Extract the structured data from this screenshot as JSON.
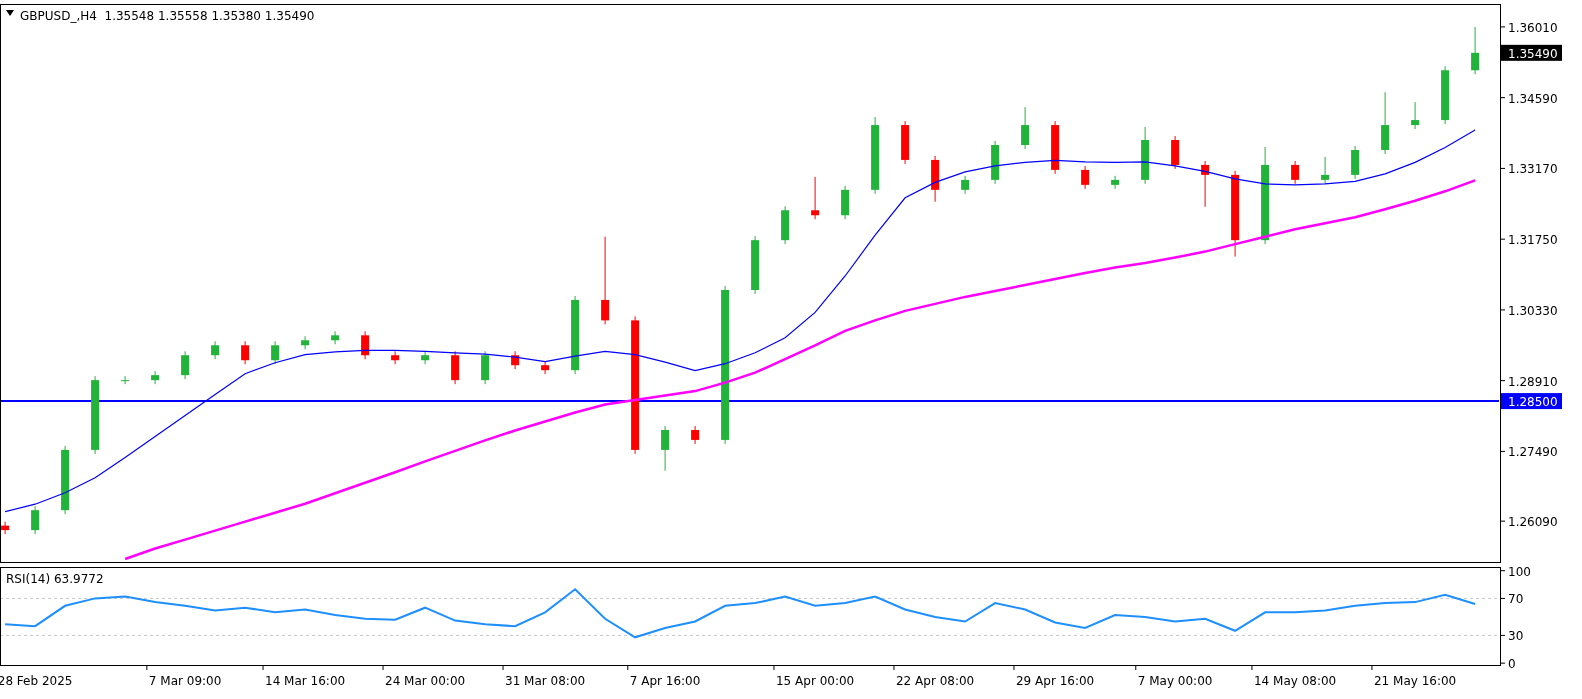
{
  "price_chart": {
    "header": "GBPUSD_,H4  1.35548 1.35558 1.35380 1.35490",
    "current_price": "1.35490",
    "chart_data": {
      "type": "candlestick",
      "categories": [
        null,
        null,
        null,
        null,
        null,
        null,
        null,
        null,
        null,
        null,
        null,
        null,
        null,
        null,
        null,
        null,
        null,
        null,
        null,
        null,
        null,
        null,
        null,
        null,
        null,
        null,
        null,
        null,
        null,
        null,
        null,
        null,
        null,
        null,
        null,
        null,
        null,
        null,
        null,
        null,
        null,
        null,
        null,
        null,
        null,
        null,
        null,
        null,
        null,
        null
      ],
      "ohlc": [
        [
          1.26,
          1.2608,
          1.2583,
          1.2591
        ],
        [
          1.2591,
          1.2639,
          1.2583,
          1.2631
        ],
        [
          1.2631,
          1.276,
          1.2623,
          1.2752
        ],
        [
          1.2752,
          1.29,
          1.2744,
          1.2892
        ],
        [
          1.2892,
          1.29,
          1.2884,
          1.2892
        ],
        [
          1.2892,
          1.291,
          1.2884,
          1.2902
        ],
        [
          1.2902,
          1.295,
          1.2894,
          1.2942
        ],
        [
          1.2942,
          1.297,
          1.2934,
          1.2962
        ],
        [
          1.2962,
          1.297,
          1.2924,
          1.2932
        ],
        [
          1.2932,
          1.297,
          1.2924,
          1.2962
        ],
        [
          1.2962,
          1.298,
          1.2954,
          1.2972
        ],
        [
          1.2972,
          1.299,
          1.2964,
          1.2982
        ],
        [
          1.2982,
          1.299,
          1.2934,
          1.2942
        ],
        [
          1.2942,
          1.295,
          1.2924,
          1.2932
        ],
        [
          1.2932,
          1.295,
          1.2924,
          1.2942
        ],
        [
          1.2942,
          1.295,
          1.2884,
          1.2892
        ],
        [
          1.2892,
          1.295,
          1.2884,
          1.2942
        ],
        [
          1.2942,
          1.295,
          1.2914,
          1.2922
        ],
        [
          1.2922,
          1.293,
          1.2904,
          1.2912
        ],
        [
          1.2912,
          1.3061,
          1.2904,
          1.3053
        ],
        [
          1.3053,
          1.318,
          1.3004,
          1.3012
        ],
        [
          1.3012,
          1.302,
          1.2744,
          1.2752
        ],
        [
          1.2752,
          1.28,
          1.271,
          1.2792
        ],
        [
          1.2792,
          1.28,
          1.2764,
          1.2772
        ],
        [
          1.2772,
          1.3081,
          1.2764,
          1.3073
        ],
        [
          1.3073,
          1.3181,
          1.3065,
          1.3173
        ],
        [
          1.3173,
          1.3241,
          1.3165,
          1.3233
        ],
        [
          1.3233,
          1.33,
          1.3215,
          1.3223
        ],
        [
          1.3223,
          1.3282,
          1.3215,
          1.3274
        ],
        [
          1.3274,
          1.342,
          1.3266,
          1.3404
        ],
        [
          1.3404,
          1.3412,
          1.3326,
          1.3334
        ],
        [
          1.3334,
          1.3342,
          1.325,
          1.3274
        ],
        [
          1.3274,
          1.3302,
          1.3266,
          1.3294
        ],
        [
          1.3294,
          1.3372,
          1.3286,
          1.3364
        ],
        [
          1.3364,
          1.344,
          1.3356,
          1.3404
        ],
        [
          1.3404,
          1.3412,
          1.3306,
          1.3314
        ],
        [
          1.3314,
          1.3322,
          1.3276,
          1.3284
        ],
        [
          1.3284,
          1.3302,
          1.3276,
          1.3294
        ],
        [
          1.3294,
          1.34,
          1.3286,
          1.3374
        ],
        [
          1.3374,
          1.3382,
          1.3316,
          1.3324
        ],
        [
          1.3324,
          1.3332,
          1.324,
          1.3304
        ],
        [
          1.3304,
          1.3312,
          1.314,
          1.3173
        ],
        [
          1.3173,
          1.336,
          1.3165,
          1.3324
        ],
        [
          1.3324,
          1.3332,
          1.3286,
          1.3294
        ],
        [
          1.3294,
          1.334,
          1.3286,
          1.3304
        ],
        [
          1.3304,
          1.3362,
          1.3296,
          1.3354
        ],
        [
          1.3354,
          1.347,
          1.3346,
          1.3404
        ],
        [
          1.3404,
          1.345,
          1.3396,
          1.3414
        ],
        [
          1.3414,
          1.3522,
          1.3406,
          1.3514
        ],
        [
          1.3514,
          1.3601,
          1.3506,
          1.3549
        ]
      ],
      "series": [
        {
          "type": "line",
          "color": "#0000ff",
          "values": [
            1.2628,
            1.2643,
            1.2666,
            1.2696,
            1.2737,
            1.2779,
            1.2821,
            1.2863,
            1.2905,
            1.2927,
            1.2943,
            1.2949,
            1.2952,
            1.2952,
            1.295,
            1.2947,
            1.2944,
            1.2938,
            1.2929,
            1.294,
            1.295,
            1.2943,
            1.2928,
            1.2911,
            1.2925,
            1.2947,
            1.2977,
            1.3028,
            1.3101,
            1.3183,
            1.3258,
            1.3289,
            1.331,
            1.3322,
            1.3329,
            1.3333,
            1.333,
            1.3329,
            1.333,
            1.3322,
            1.3311,
            1.3296,
            1.3286,
            1.3284,
            1.3286,
            1.3291,
            1.3306,
            1.3329,
            1.3359,
            1.3394
          ]
        },
        {
          "type": "line",
          "color": "#ff00ff",
          "values": [
            null,
            null,
            null,
            null,
            1.2533,
            1.2554,
            1.2572,
            1.259,
            1.2608,
            1.2626,
            1.2644,
            1.2665,
            1.2686,
            1.2707,
            1.2729,
            1.275,
            1.2771,
            1.2791,
            1.2809,
            1.2827,
            1.2843,
            1.2852,
            1.2861,
            1.287,
            1.2887,
            1.2907,
            1.2934,
            1.2962,
            1.2991,
            1.3012,
            1.3031,
            1.3045,
            1.3059,
            1.3071,
            1.3083,
            1.3095,
            1.3107,
            1.3118,
            1.3127,
            1.3138,
            1.315,
            1.3165,
            1.318,
            1.3195,
            1.3207,
            1.3219,
            1.3235,
            1.3252,
            1.3271,
            1.3293
          ]
        }
      ],
      "ylim": [
        1.2527,
        1.3647
      ],
      "yticks": [
        {
          "value": 1.3601,
          "label": "1.36010"
        },
        {
          "value": 1.3459,
          "label": "1.34590"
        },
        {
          "value": 1.3317,
          "label": "1.33170"
        },
        {
          "value": 1.3175,
          "label": "1.31750"
        },
        {
          "value": 1.3033,
          "label": "1.30330"
        },
        {
          "value": 1.2891,
          "label": "1.28910"
        },
        {
          "value": 1.2749,
          "label": "1.27490"
        },
        {
          "value": 1.2609,
          "label": "1.26090"
        }
      ],
      "ref_lines": [
        {
          "axis": "y",
          "value": 1.285,
          "label": "1.28500",
          "color": "#0000ff"
        }
      ]
    }
  },
  "rsi_chart": {
    "chart_data": {
      "type": "line",
      "title": "RSI(14) 63.9772",
      "categories": [
        null,
        "28 Feb 2025",
        null,
        null,
        null,
        null,
        "7 Mar 09:00",
        null,
        null,
        null,
        "14 Mar 16:00",
        null,
        null,
        null,
        "24 Mar 00:00",
        null,
        null,
        null,
        "31 Mar 08:00",
        null,
        null,
        null,
        "7 Apr 16:00",
        null,
        null,
        null,
        null,
        "15 Apr 00:00",
        null,
        null,
        null,
        "22 Apr 08:00",
        null,
        null,
        null,
        "29 Apr 16:00",
        null,
        null,
        null,
        "7 May 00:00",
        null,
        null,
        null,
        "14 May 08:00",
        null,
        null,
        null,
        "21 May 16:00",
        null,
        null
      ],
      "series": [
        {
          "color": "#1e8fff",
          "values": [
            42,
            40,
            62,
            70,
            72,
            66,
            62,
            57,
            60,
            55,
            58,
            52,
            48,
            47,
            60,
            46,
            42,
            40,
            55,
            80,
            48,
            28,
            38,
            45,
            62,
            65,
            72,
            62,
            65,
            72,
            58,
            50,
            45,
            65,
            58,
            44,
            38,
            52,
            50,
            45,
            48,
            35,
            55,
            55,
            57,
            62,
            65,
            66,
            74,
            64
          ]
        }
      ],
      "ylim": [
        -2,
        104
      ],
      "yticks": [
        0,
        30,
        70,
        100
      ],
      "ref_lines": [
        {
          "axis": "y",
          "value": 70
        },
        {
          "axis": "y",
          "value": 30
        }
      ]
    }
  }
}
